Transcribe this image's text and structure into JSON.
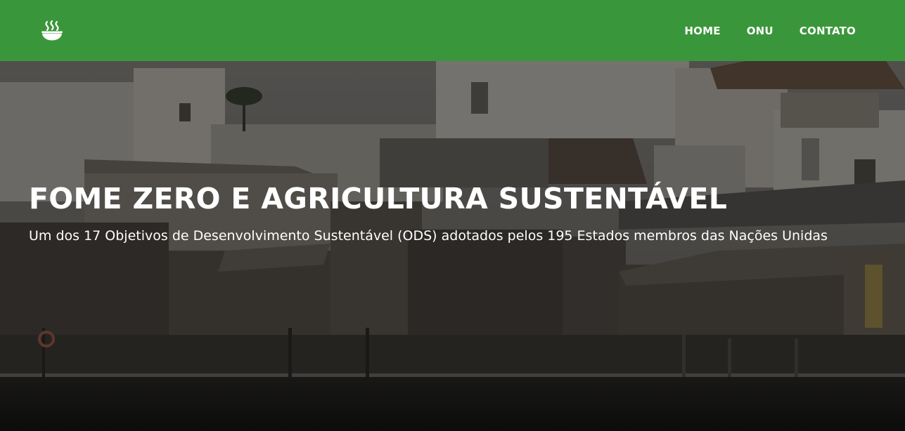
{
  "navbar": {
    "logo_icon": "soup-bowl-icon",
    "background_color": "#3a963a",
    "links": [
      {
        "label": "HOME"
      },
      {
        "label": "ONU"
      },
      {
        "label": "CONTATO"
      }
    ]
  },
  "hero": {
    "title": "FOME ZERO E AGRICULTURA SUSTENTÁVEL",
    "subtitle": "Um dos 17 Objetivos de Desenvolvimento Sustentável (ODS) adotados pelos 195 Estados membros das Nações Unidas",
    "background_image": "riverside-shacks-photo"
  }
}
